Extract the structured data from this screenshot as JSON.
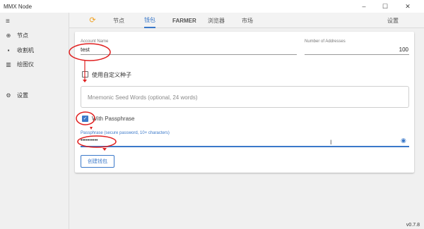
{
  "window": {
    "title": "MMX Node",
    "min_glyph": "–",
    "max_glyph": "☐",
    "close_glyph": "✕"
  },
  "sidebar": {
    "menu_icon": "≡",
    "items": [
      {
        "label": "节点",
        "icon": "globe-icon",
        "glyph": "⊕"
      },
      {
        "label": "收割机",
        "icon": "harvester-icon",
        "glyph": "▪"
      },
      {
        "label": "绘图仪",
        "icon": "plotter-icon",
        "glyph": "▥"
      },
      {
        "label": "设置",
        "icon": "gear-icon",
        "glyph": "⚙"
      }
    ]
  },
  "topnav": {
    "sync_glyph": "⟳",
    "tabs": [
      {
        "label": "节点"
      },
      {
        "label": "钱包"
      },
      {
        "label": "FARMER"
      },
      {
        "label": "浏览器"
      },
      {
        "label": "市场"
      },
      {
        "label": "设置"
      }
    ]
  },
  "form": {
    "account_name_label": "Account Name",
    "account_name_value": "test",
    "num_addresses_label": "Number of Addresses",
    "num_addresses_value": "100",
    "custom_seed_label": "使用自定义种子",
    "custom_seed_checked": false,
    "seed_placeholder": "Mnemonic Seed Words (optional, 24 words)",
    "passphrase_checkbox_label": "With Passphrase",
    "passphrase_checked": true,
    "check_glyph": "✓",
    "passphrase_field_label": "Passphrase (secure password, 10+ characters)",
    "passphrase_value": "••••••••••",
    "eye_glyph": "◉",
    "create_button": "创建钱包"
  },
  "version": "v0.7.8",
  "colors": {
    "accent": "#3a78c9",
    "annotation": "#e02020",
    "sync": "#f0a020"
  }
}
